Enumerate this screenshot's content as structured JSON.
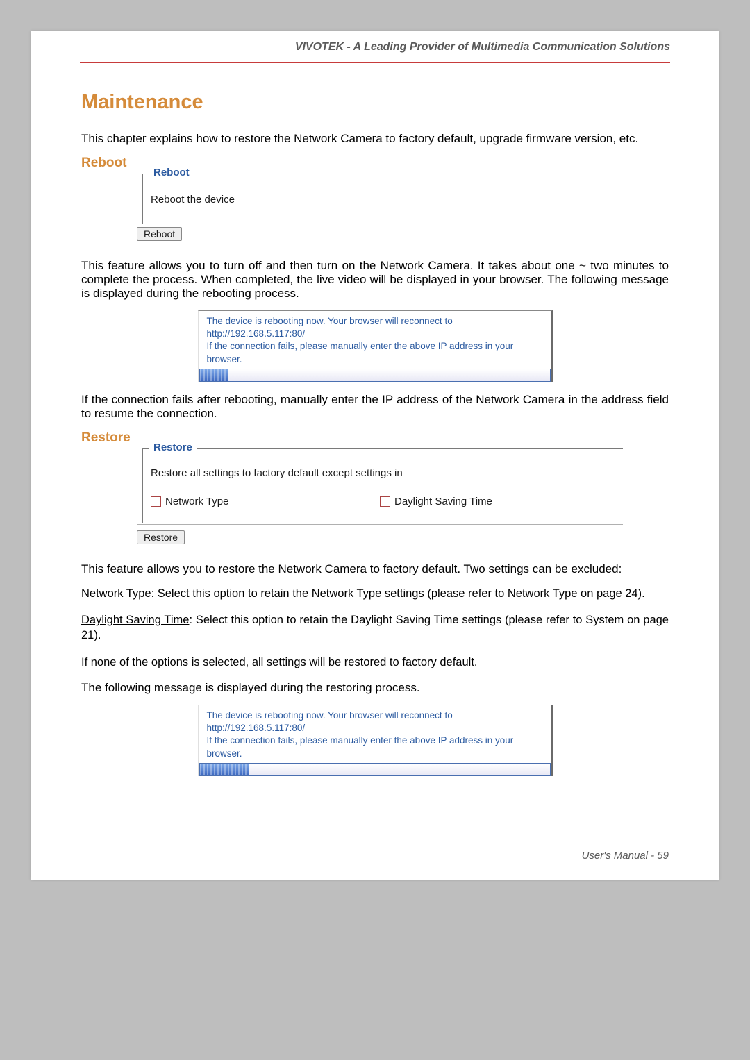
{
  "header": {
    "banner": "VIVOTEK - A Leading Provider of Multimedia Communication Solutions"
  },
  "title": "Maintenance",
  "intro": "This chapter explains how to restore the Network Camera to factory default, upgrade firmware version, etc.",
  "reboot": {
    "heading": "Reboot",
    "legend": "Reboot",
    "desc": "Reboot the device",
    "button": "Reboot",
    "para1": "This feature allows you to turn off and then turn on the Network Camera. It takes about one ~ two minutes to complete the process. When completed, the live video will be displayed in your browser. The following message is displayed during the rebooting process.",
    "msg_line1": "The device is rebooting now. Your browser will reconnect to",
    "msg_line2": "http://192.168.5.117:80/",
    "msg_line3": "If the connection fails, please manually enter the above IP address in your",
    "msg_line4": "browser.",
    "para2": "If the connection fails after rebooting, manually enter the IP address of the Network Camera in the address field to resume the connection."
  },
  "restore": {
    "heading": "Restore",
    "legend": "Restore",
    "desc": "Restore all settings to factory default except settings in",
    "cb1": "Network Type",
    "cb2": "Daylight Saving Time",
    "button": "Restore",
    "para1": "This feature allows you to restore the Network Camera to factory default. Two settings can be excluded:",
    "nt_label": "Network Type",
    "nt_rest": ": Select this option to retain the Network Type settings (please refer to Network Type on page 24).",
    "dst_label": "Daylight Saving Time",
    "dst_rest": ": Select this option to retain the Daylight Saving Time settings (please refer to System on page 21).",
    "para_none": "If none of the options is selected, all settings will be restored to factory default.",
    "para_msg": "The following message is displayed during the restoring process.",
    "msg_line1": "The device is rebooting now. Your browser will reconnect to",
    "msg_line2": "http://192.168.5.117:80/",
    "msg_line3": "If the connection fails, please manually enter the above IP address in your",
    "msg_line4": "browser."
  },
  "footer": "User's Manual - 59"
}
